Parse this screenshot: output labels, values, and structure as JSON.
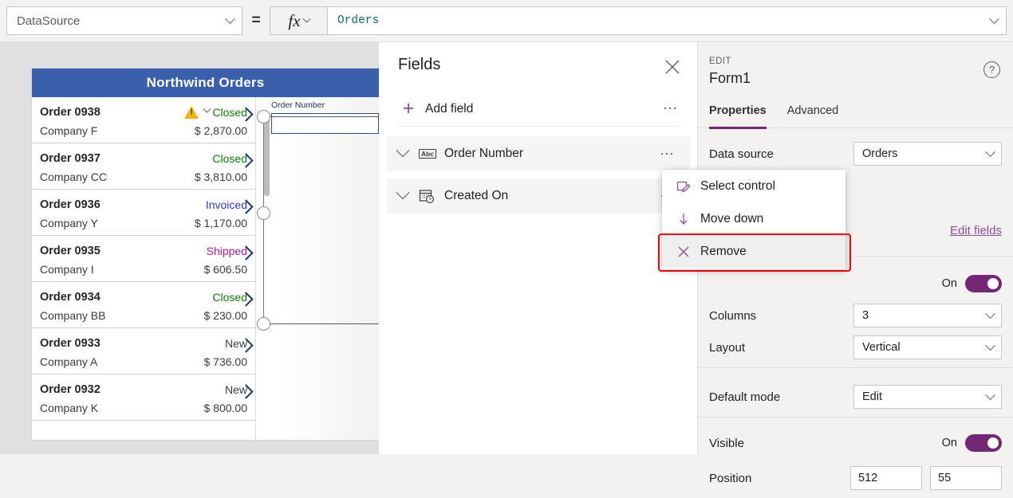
{
  "formula_bar": {
    "property_selector": {
      "value": "DataSource",
      "icon": "chevron-down-icon"
    },
    "equals": "=",
    "fx_label": "fx",
    "formula_value": "Orders"
  },
  "canvas": {
    "app_header_title": "Northwind Orders",
    "gallery": {
      "items": [
        {
          "order": "Order 0938",
          "company": "Company F",
          "status": "Closed",
          "status_color": "#107c10",
          "amount": "$ 2,870.00",
          "has_warning": true
        },
        {
          "order": "Order 0937",
          "company": "Company CC",
          "status": "Closed",
          "status_color": "#107c10",
          "amount": "$ 3,810.00",
          "has_warning": false
        },
        {
          "order": "Order 0936",
          "company": "Company Y",
          "status": "Invoiced",
          "status_color": "#3232d2",
          "amount": "$ 1,170.00",
          "has_warning": false
        },
        {
          "order": "Order 0935",
          "company": "Company I",
          "status": "Shipped",
          "status_color": "#b4199b",
          "amount": "$ 606.50",
          "has_warning": false
        },
        {
          "order": "Order 0934",
          "company": "Company BB",
          "status": "Closed",
          "status_color": "#107c10",
          "amount": "$ 230.00",
          "has_warning": false
        },
        {
          "order": "Order 0933",
          "company": "Company A",
          "status": "New",
          "status_color": "#3b3b3b",
          "amount": "$ 736.00",
          "has_warning": false
        },
        {
          "order": "Order 0932",
          "company": "Company K",
          "status": "New",
          "status_color": "#3b3b3b",
          "amount": "$ 800.00",
          "has_warning": false
        }
      ]
    },
    "form": {
      "field_label": "Order Number",
      "field_value": ""
    }
  },
  "fields_panel": {
    "title": "Fields",
    "close_icon": "close-icon",
    "add_field_label": "Add field",
    "add_field_icon": "plus-icon",
    "overflow_icon": "ellipsis-icon",
    "fields": [
      {
        "name": "Order Number",
        "type_icon": "text-field-icon",
        "type_glyph": "Abc"
      },
      {
        "name": "Created On",
        "type_icon": "date-time-icon",
        "type_glyph": ""
      }
    ]
  },
  "context_menu": {
    "items": [
      {
        "label": "Select control",
        "icon": "edit-control-icon",
        "highlighted": false
      },
      {
        "label": "Move down",
        "icon": "arrow-down-icon",
        "highlighted": false
      },
      {
        "label": "Remove",
        "icon": "close-x-icon",
        "highlighted": true
      }
    ],
    "highlight_color": "#ff0000"
  },
  "properties_panel": {
    "kicker": "EDIT",
    "control_name": "Form1",
    "help_icon": "help-icon",
    "tabs": [
      {
        "label": "Properties",
        "active": true
      },
      {
        "label": "Advanced",
        "active": false
      }
    ],
    "accent_color": "#742774",
    "data_source": {
      "label": "Data source",
      "value": "Orders"
    },
    "edit_fields_link": "Edit fields",
    "snap_toggle": {
      "state_label": "On"
    },
    "columns": {
      "label": "Columns",
      "value": "3"
    },
    "layout": {
      "label": "Layout",
      "value": "Vertical"
    },
    "default_mode": {
      "label": "Default mode",
      "value": "Edit"
    },
    "visible": {
      "label": "Visible",
      "state_label": "On"
    },
    "position": {
      "label": "Position",
      "x": "512",
      "y": "55"
    }
  }
}
